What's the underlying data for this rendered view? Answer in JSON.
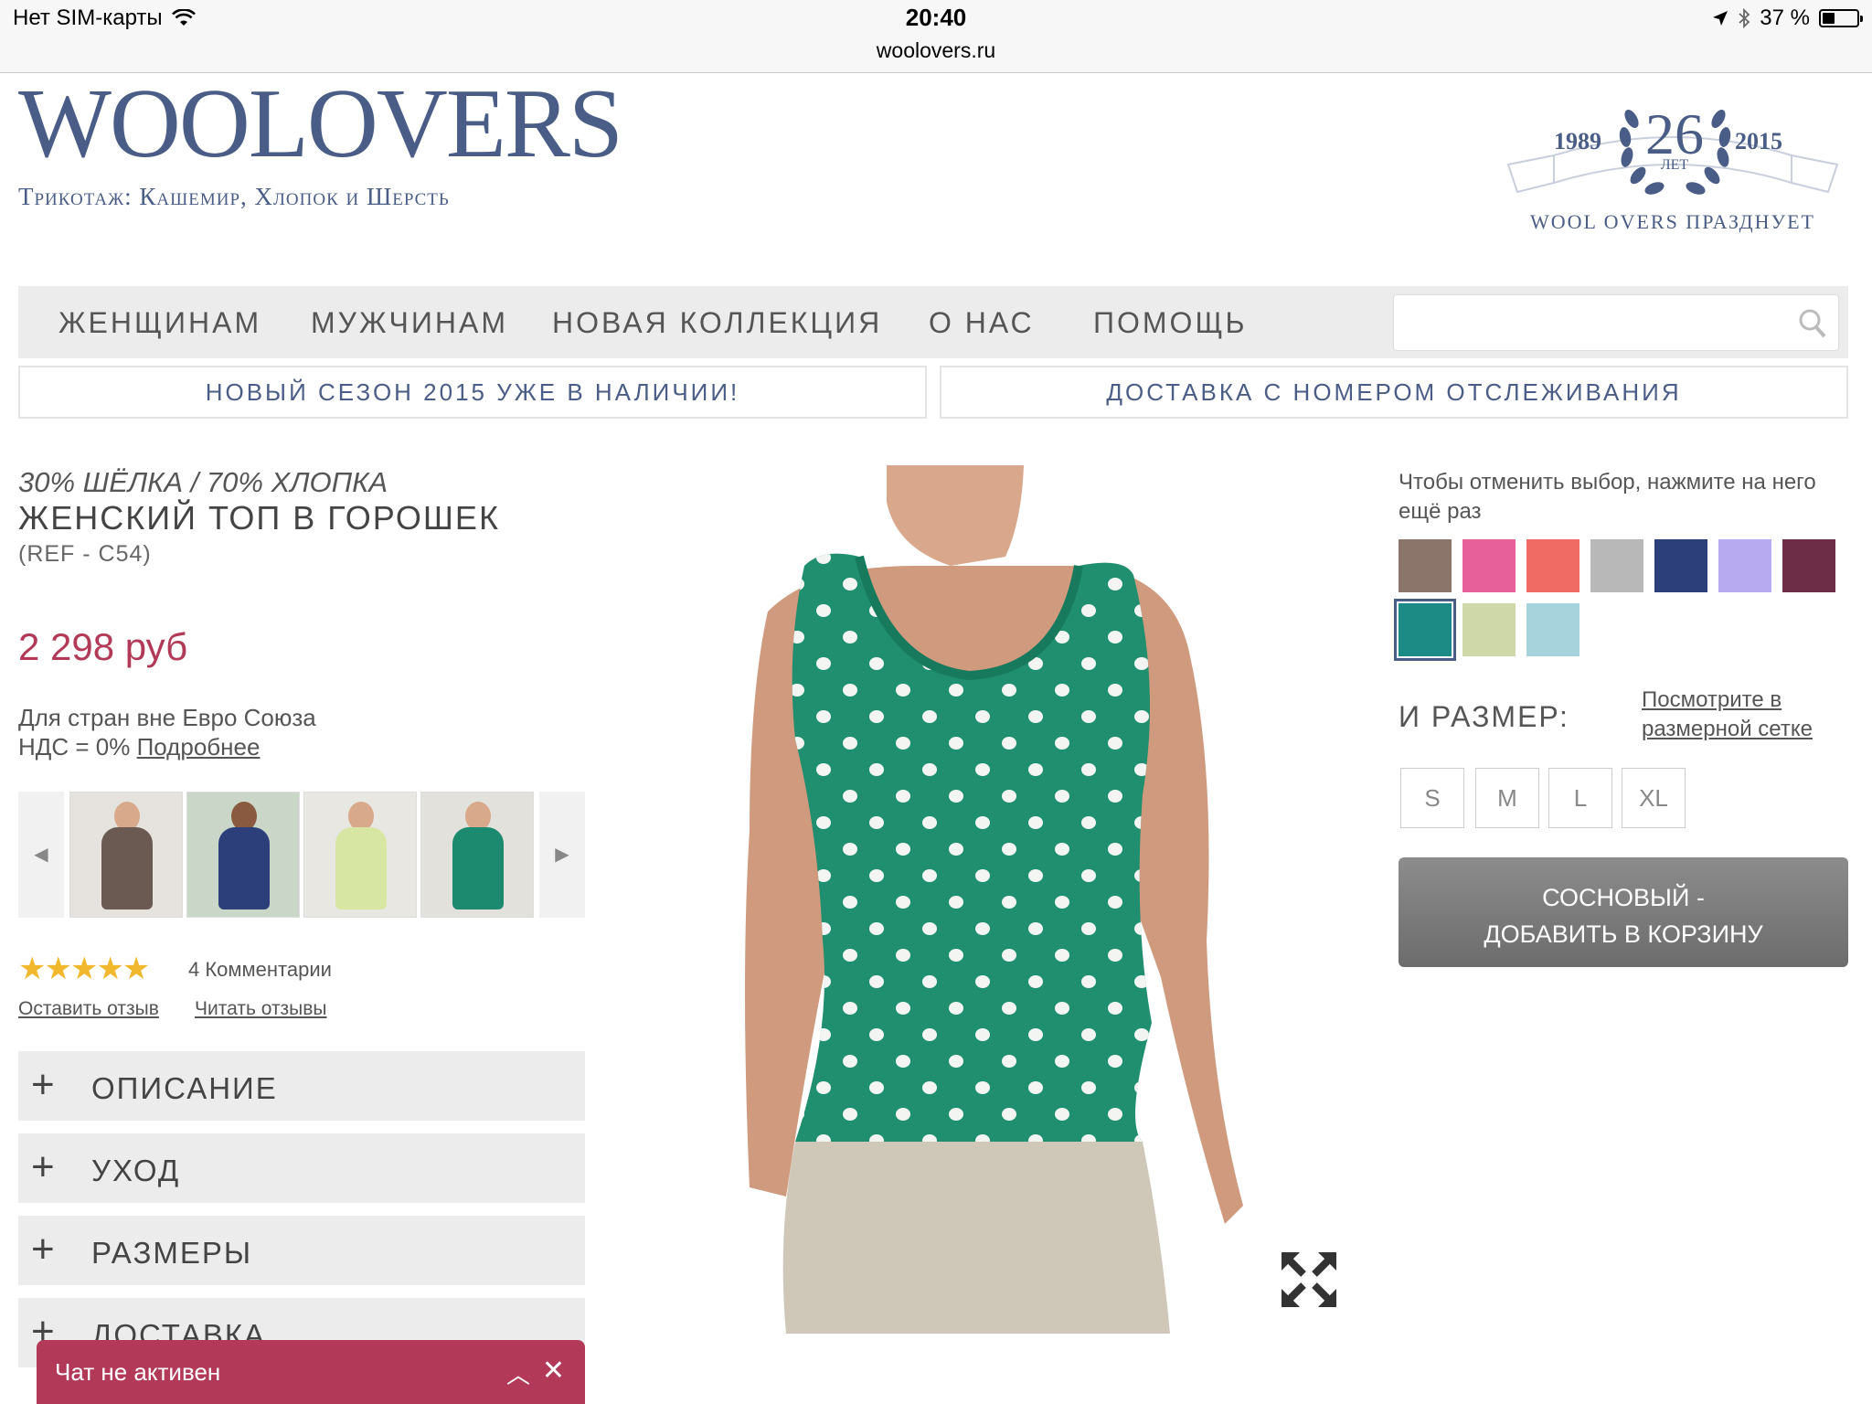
{
  "status_bar": {
    "carrier": "Нет SIM-карты",
    "time": "20:40",
    "url": "woolovers.ru",
    "battery": "37 %",
    "battery_level": 0.37
  },
  "header": {
    "logo": "WOOLOVERS",
    "tagline": "Трикотаж: Кашемир, Хлопок и Шерсть",
    "badge": {
      "year_start": "1989",
      "years": "26",
      "years_unit": "ЛЕТ",
      "year_end": "2015",
      "caption": "WOOL OVERS ПРАЗДНУЕТ"
    }
  },
  "nav": {
    "items": [
      "ЖЕНЩИНАМ",
      "МУЖЧИНАМ",
      "НОВАЯ КОЛЛЕКЦИЯ",
      "О НАС",
      "ПОМОЩЬ"
    ],
    "search_placeholder": ""
  },
  "promo": {
    "left": "НОВЫЙ СЕЗОН 2015 УЖЕ В НАЛИЧИИ!",
    "right": "ДОСТАВКА С НОМЕРОМ ОТСЛЕЖИВАНИЯ"
  },
  "product": {
    "composition": "30% ШЁЛКА / 70% ХЛОПКА",
    "title": "ЖЕНСКИЙ ТОП В ГОРОШЕК",
    "ref": "(REF - C54)",
    "price": "2 298 руб",
    "vat_line1": "Для стран вне Евро Союза",
    "vat_line2": "НДС = 0%",
    "vat_link": "Подробнее",
    "rating": 4.5,
    "rating_stars": "★★★★★",
    "comments": "4 Комментарии",
    "leave_review": "Оставить отзыв",
    "read_reviews": "Читать отзывы"
  },
  "accordion": [
    "ОПИСАНИЕ",
    "УХОД",
    "РАЗМЕРЫ",
    "ДОСТАВКА"
  ],
  "chat": {
    "label": "Чат не активен"
  },
  "options": {
    "instruction": "Чтобы отменить выбор, нажмите на него ещё раз",
    "colors": [
      "#8b7469",
      "#e8609a",
      "#ef6b63",
      "#b8b8b8",
      "#2d3f7a",
      "#b7aaf0",
      "#6e2d47",
      "#1c8a85",
      "#cfd8a8",
      "#a7d3dc"
    ],
    "selected_color_index": 7,
    "size_label": "И РАЗМЕР:",
    "size_link": "Посмотрите в размерной сетке",
    "sizes": [
      "S",
      "M",
      "L",
      "XL"
    ],
    "cart_line1": "СОСНОВЫЙ -",
    "cart_line2": "ДОБАВИТЬ В КОРЗИНУ"
  }
}
